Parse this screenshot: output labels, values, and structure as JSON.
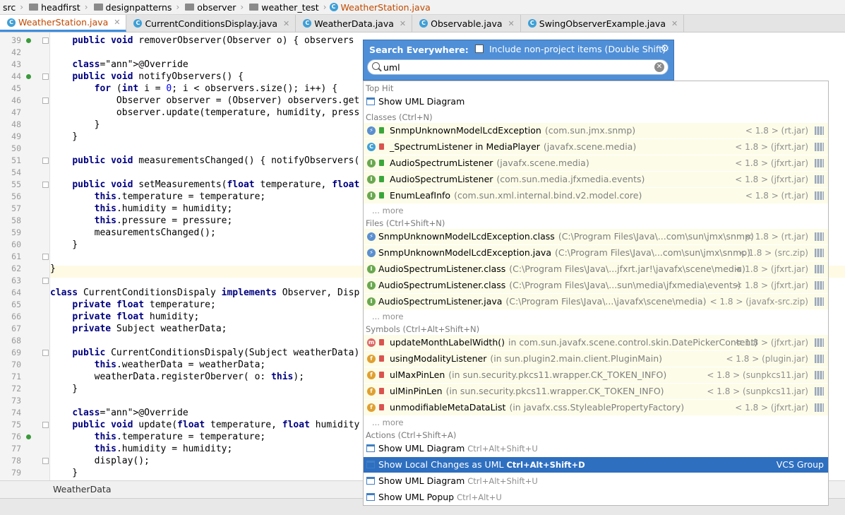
{
  "breadcrumb": [
    "src",
    "headfirst",
    "designpatterns",
    "observer",
    "weather_test",
    "WeatherStation.java"
  ],
  "tabs": [
    {
      "label": "WeatherStation.java",
      "active": true
    },
    {
      "label": "CurrentConditionsDisplay.java",
      "active": false
    },
    {
      "label": "WeatherData.java",
      "active": false
    },
    {
      "label": "Observable.java",
      "active": false
    },
    {
      "label": "SwingObserverExample.java",
      "active": false
    }
  ],
  "code": [
    {
      "n": "39",
      "t": "    public void removerObserver(Observer o) { observers"
    },
    {
      "n": "42",
      "t": ""
    },
    {
      "n": "43",
      "t": "    @Override"
    },
    {
      "n": "44",
      "t": "    public void notifyObservers() {"
    },
    {
      "n": "45",
      "t": "        for (int i = 0; i < observers.size(); i++) {"
    },
    {
      "n": "46",
      "t": "            Observer observer = (Observer) observers.get"
    },
    {
      "n": "47",
      "t": "            observer.update(temperature, humidity, press"
    },
    {
      "n": "48",
      "t": "        }"
    },
    {
      "n": "49",
      "t": "    }"
    },
    {
      "n": "50",
      "t": ""
    },
    {
      "n": "51",
      "t": "    public void measurementsChanged() { notifyObservers("
    },
    {
      "n": "54",
      "t": ""
    },
    {
      "n": "55",
      "t": "    public void setMeasurements(float temperature, float"
    },
    {
      "n": "56",
      "t": "        this.temperature = temperature;"
    },
    {
      "n": "57",
      "t": "        this.humidity = humidity;"
    },
    {
      "n": "58",
      "t": "        this.pressure = pressure;"
    },
    {
      "n": "59",
      "t": "        measurementsChanged();"
    },
    {
      "n": "60",
      "t": "    }"
    },
    {
      "n": "61",
      "t": ""
    },
    {
      "n": "62",
      "t": "}"
    },
    {
      "n": "63",
      "t": ""
    },
    {
      "n": "64",
      "t": "class CurrentConditionsDispaly implements Observer, Disp"
    },
    {
      "n": "65",
      "t": "    private float temperature;"
    },
    {
      "n": "66",
      "t": "    private float humidity;"
    },
    {
      "n": "67",
      "t": "    private Subject weatherData;"
    },
    {
      "n": "68",
      "t": ""
    },
    {
      "n": "69",
      "t": "    public CurrentConditionsDispaly(Subject weatherData)"
    },
    {
      "n": "70",
      "t": "        this.weatherData = weatherData;"
    },
    {
      "n": "71",
      "t": "        weatherData.registerOberver( o: this);"
    },
    {
      "n": "72",
      "t": "    }"
    },
    {
      "n": "73",
      "t": ""
    },
    {
      "n": "74",
      "t": "    @Override"
    },
    {
      "n": "75",
      "t": "    public void update(float temperature, float humidity"
    },
    {
      "n": "76",
      "t": "        this.temperature = temperature;"
    },
    {
      "n": "77",
      "t": "        this.humidity = humidity;"
    },
    {
      "n": "78",
      "t": "        display();"
    },
    {
      "n": "79",
      "t": "    }"
    }
  ],
  "status_bar": {
    "text": "WeatherData"
  },
  "search": {
    "title": "Search Everywhere:",
    "include_label": "Include non-project items (Double Shift)",
    "query": "uml"
  },
  "results": {
    "top_hit": {
      "header": "Top Hit",
      "label": "Show UML Diagram"
    },
    "classes": {
      "header": "Classes (Ctrl+N)",
      "items": [
        {
          "name": "SnmpUnknownModelLcdException",
          "pkg": "(com.sun.jmx.snmp)",
          "ver": "< 1.8 > (rt.jar)",
          "icon": "exception-class-icon"
        },
        {
          "name": "_SpectrumListener in MediaPlayer",
          "pkg": "(javafx.scene.media)",
          "ver": "< 1.8 > (jfxrt.jar)",
          "icon": "class-icon"
        },
        {
          "name": "AudioSpectrumListener",
          "pkg": "(javafx.scene.media)",
          "ver": "< 1.8 > (jfxrt.jar)",
          "icon": "interface-icon"
        },
        {
          "name": "AudioSpectrumListener",
          "pkg": "(com.sun.media.jfxmedia.events)",
          "ver": "< 1.8 > (jfxrt.jar)",
          "icon": "interface-icon"
        },
        {
          "name": "EnumLeafInfo",
          "pkg": "(com.sun.xml.internal.bind.v2.model.core)",
          "ver": "< 1.8 > (rt.jar)",
          "icon": "interface-icon"
        }
      ]
    },
    "files": {
      "header": "Files (Ctrl+Shift+N)",
      "items": [
        {
          "name": "SnmpUnknownModelLcdException.class",
          "pkg": "(C:\\Program Files\\Java\\...com\\sun\\jmx\\snmp)",
          "ver": "< 1.8 > (rt.jar)"
        },
        {
          "name": "SnmpUnknownModelLcdException.java",
          "pkg": "(C:\\Program Files\\Java\\...com\\sun\\jmx\\snmp)",
          "ver": "< 1.8 > (src.zip)"
        },
        {
          "name": "AudioSpectrumListener.class",
          "pkg": "(C:\\Program Files\\Java\\...jfxrt.jar!\\javafx\\scene\\media)",
          "ver": "< 1.8 > (jfxrt.jar)"
        },
        {
          "name": "AudioSpectrumListener.class",
          "pkg": "(C:\\Program Files\\Java\\...sun\\media\\jfxmedia\\events)",
          "ver": "< 1.8 > (jfxrt.jar)"
        },
        {
          "name": "AudioSpectrumListener.java",
          "pkg": "(C:\\Program Files\\Java\\...\\javafx\\scene\\media)",
          "ver": "< 1.8 > (javafx-src.zip)"
        }
      ]
    },
    "symbols": {
      "header": "Symbols (Ctrl+Alt+Shift+N)",
      "items": [
        {
          "name": "updateMonthLabelWidth()",
          "pkg": "in com.sun.javafx.scene.control.skin.DatePickerContent)",
          "ver": "< 1.8 > (jfxrt.jar)",
          "icon": "method-icon"
        },
        {
          "name": "usingModalityListener",
          "pkg": "(in sun.plugin2.main.client.PluginMain)",
          "ver": "< 1.8 > (plugin.jar)",
          "icon": "field-icon"
        },
        {
          "name": "ulMaxPinLen",
          "pkg": "(in sun.security.pkcs11.wrapper.CK_TOKEN_INFO)",
          "ver": "< 1.8 > (sunpkcs11.jar)",
          "icon": "field-icon"
        },
        {
          "name": "ulMinPinLen",
          "pkg": "(in sun.security.pkcs11.wrapper.CK_TOKEN_INFO)",
          "ver": "< 1.8 > (sunpkcs11.jar)",
          "icon": "field-icon"
        },
        {
          "name": "unmodifiableMetaDataList",
          "pkg": "(in javafx.css.StyleablePropertyFactory)",
          "ver": "< 1.8 > (jfxrt.jar)",
          "icon": "field-icon"
        }
      ]
    },
    "more_label": "... more",
    "actions": {
      "header": "Actions (Ctrl+Shift+A)",
      "items": [
        {
          "name": "Show UML Diagram",
          "shortcut": "Ctrl+Alt+Shift+U",
          "group": ""
        },
        {
          "name": "Show Local Changes as UML",
          "shortcut": "Ctrl+Alt+Shift+D",
          "group": "VCS Group"
        },
        {
          "name": "Show UML Diagram",
          "shortcut": "Ctrl+Alt+Shift+U",
          "group": ""
        },
        {
          "name": "Show UML Popup",
          "shortcut": "Ctrl+Alt+U",
          "group": ""
        }
      ]
    }
  },
  "colors": {
    "accent": "#2e6fc0",
    "popup_header": "#4f8fd8",
    "highlight_row": "#fdfce8"
  }
}
